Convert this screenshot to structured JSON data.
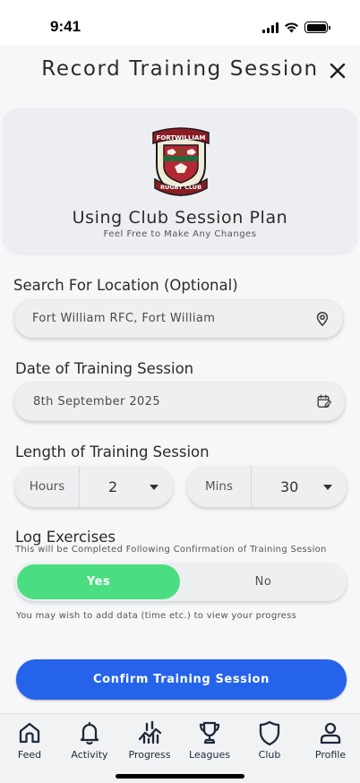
{
  "status_bar": {
    "time": "9:41"
  },
  "header": {
    "title": "Record Training Session",
    "close_icon": "close-icon"
  },
  "plan": {
    "crest_top_text": "FORTWILLIAM",
    "crest_bottom_text": "RUGBY CLUB",
    "title": "Using Club Session Plan",
    "subtitle": "Feel Free to Make Any Changes"
  },
  "location": {
    "label": "Search For Location (Optional)",
    "value": "Fort William RFC, Fort William",
    "icon": "map-pin-icon"
  },
  "date": {
    "label": "Date of Training Session",
    "value": "8th September 2025",
    "icon": "calendar-edit-icon"
  },
  "length": {
    "label": "Length of Training Session",
    "hours_label": "Hours",
    "hours_value": "2",
    "mins_label": "Mins",
    "mins_value": "30"
  },
  "log": {
    "title": "Log Exercises",
    "subtitle": "This will be Completed Following Confirmation of Training Session",
    "yes_label": "Yes",
    "no_label": "No",
    "selected": "Yes",
    "hint": "You may wish to add data (time etc.) to view your progress"
  },
  "confirm_label": "Confirm Training Session",
  "tabs": [
    {
      "label": "Feed",
      "icon": "home-icon"
    },
    {
      "label": "Activity",
      "icon": "bell-icon"
    },
    {
      "label": "Progress",
      "icon": "chart-trend-icon"
    },
    {
      "label": "Leagues",
      "icon": "trophy-icon"
    },
    {
      "label": "Club",
      "icon": "shield-icon"
    },
    {
      "label": "Profile",
      "icon": "user-icon"
    }
  ],
  "colors": {
    "accent_blue": "#2563eb",
    "toggle_green": "#4ade80",
    "background": "#f6f7f9"
  }
}
